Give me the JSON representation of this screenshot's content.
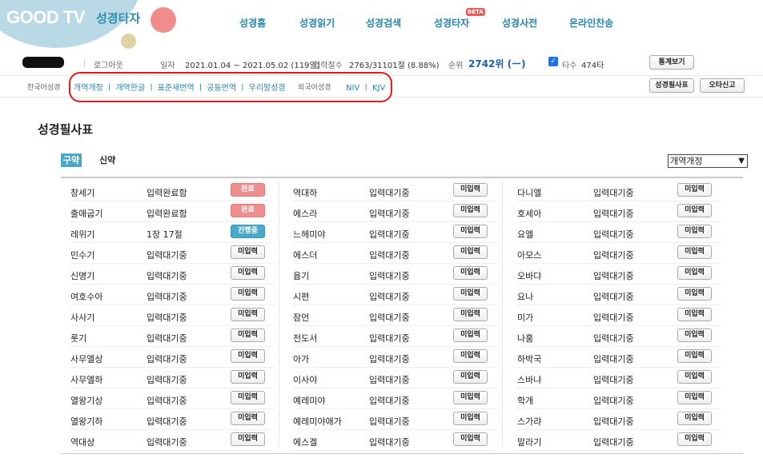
{
  "brand": {
    "logo": "GOOD TV",
    "subtitle": "성경타자"
  },
  "nav": {
    "items": [
      "성경홈",
      "성경읽기",
      "성경검색",
      "성경타자",
      "성경사전",
      "온라인찬송"
    ],
    "beta": "BETA"
  },
  "info": {
    "logout": "로그아웃",
    "period_label": "일자",
    "period_value": "2021.01.04 ~ 2021.05.02 (119일)",
    "verses_label": "입력절수",
    "verses_value": "2763/31101절 (8.88%)",
    "rank_label": "순위",
    "rank_value": "2742위 (ー)",
    "typing_label": "타수",
    "typing_value": "474타",
    "stats_button": "통계보기"
  },
  "subbar": {
    "korean_label": "한국어성경",
    "korean_versions": "개역개정 ㅣ 개역한글 ㅣ 표준새번역 ㅣ 공동번역 ㅣ 우리말성경",
    "foreign_label": "외국어성경",
    "foreign_versions": "NIV ㅣ KJV",
    "copy_button": "성경필사표",
    "typo_button": "오타신고"
  },
  "page": {
    "title": "성경필사표",
    "tab_old": "구약",
    "tab_new": "신약",
    "version_select": "개역개정"
  },
  "colors": {
    "accent": "#2586ad",
    "done": "#ee8f8f",
    "progress": "#4aa8c9",
    "highlight": "#e01b1b"
  },
  "columns": [
    [
      {
        "book": "창세기",
        "status": "입력완료함",
        "button": "완료",
        "state": "done"
      },
      {
        "book": "출애굽기",
        "status": "입력완료함",
        "button": "완료",
        "state": "done"
      },
      {
        "book": "레위기",
        "status": "1장 17절",
        "button": "진행중",
        "state": "prog"
      },
      {
        "book": "민수기",
        "status": "입력대기중",
        "button": "미입력",
        "state": "none"
      },
      {
        "book": "신명기",
        "status": "입력대기중",
        "button": "미입력",
        "state": "none"
      },
      {
        "book": "여호수아",
        "status": "입력대기중",
        "button": "미입력",
        "state": "none"
      },
      {
        "book": "사사기",
        "status": "입력대기중",
        "button": "미입력",
        "state": "none"
      },
      {
        "book": "룻기",
        "status": "입력대기중",
        "button": "미입력",
        "state": "none"
      },
      {
        "book": "사무엘상",
        "status": "입력대기중",
        "button": "미입력",
        "state": "none"
      },
      {
        "book": "사무엘하",
        "status": "입력대기중",
        "button": "미입력",
        "state": "none"
      },
      {
        "book": "열왕기상",
        "status": "입력대기중",
        "button": "미입력",
        "state": "none"
      },
      {
        "book": "열왕기하",
        "status": "입력대기중",
        "button": "미입력",
        "state": "none"
      },
      {
        "book": "역대상",
        "status": "입력대기중",
        "button": "미입력",
        "state": "none"
      }
    ],
    [
      {
        "book": "역대하",
        "status": "입력대기중",
        "button": "미입력",
        "state": "none"
      },
      {
        "book": "에스라",
        "status": "입력대기중",
        "button": "미입력",
        "state": "none"
      },
      {
        "book": "느헤미야",
        "status": "입력대기중",
        "button": "미입력",
        "state": "none"
      },
      {
        "book": "에스더",
        "status": "입력대기중",
        "button": "미입력",
        "state": "none"
      },
      {
        "book": "욥기",
        "status": "입력대기중",
        "button": "미입력",
        "state": "none"
      },
      {
        "book": "시편",
        "status": "입력대기중",
        "button": "미입력",
        "state": "none"
      },
      {
        "book": "잠언",
        "status": "입력대기중",
        "button": "미입력",
        "state": "none"
      },
      {
        "book": "전도서",
        "status": "입력대기중",
        "button": "미입력",
        "state": "none"
      },
      {
        "book": "아가",
        "status": "입력대기중",
        "button": "미입력",
        "state": "none"
      },
      {
        "book": "이사야",
        "status": "입력대기중",
        "button": "미입력",
        "state": "none"
      },
      {
        "book": "예레미야",
        "status": "입력대기중",
        "button": "미입력",
        "state": "none"
      },
      {
        "book": "예레미야애가",
        "status": "입력대기중",
        "button": "미입력",
        "state": "none"
      },
      {
        "book": "에스겔",
        "status": "입력대기중",
        "button": "미입력",
        "state": "none"
      }
    ],
    [
      {
        "book": "다니엘",
        "status": "입력대기중",
        "button": "미입력",
        "state": "none"
      },
      {
        "book": "호세아",
        "status": "입력대기중",
        "button": "미입력",
        "state": "none"
      },
      {
        "book": "요엘",
        "status": "입력대기중",
        "button": "미입력",
        "state": "none"
      },
      {
        "book": "아모스",
        "status": "입력대기중",
        "button": "미입력",
        "state": "none"
      },
      {
        "book": "오바댜",
        "status": "입력대기중",
        "button": "미입력",
        "state": "none"
      },
      {
        "book": "요나",
        "status": "입력대기중",
        "button": "미입력",
        "state": "none"
      },
      {
        "book": "미가",
        "status": "입력대기중",
        "button": "미입력",
        "state": "none"
      },
      {
        "book": "나훔",
        "status": "입력대기중",
        "button": "미입력",
        "state": "none"
      },
      {
        "book": "하박국",
        "status": "입력대기중",
        "button": "미입력",
        "state": "none"
      },
      {
        "book": "스바냐",
        "status": "입력대기중",
        "button": "미입력",
        "state": "none"
      },
      {
        "book": "학개",
        "status": "입력대기중",
        "button": "미입력",
        "state": "none"
      },
      {
        "book": "스가랴",
        "status": "입력대기중",
        "button": "미입력",
        "state": "none"
      },
      {
        "book": "말라기",
        "status": "입력대기중",
        "button": "미입력",
        "state": "none"
      }
    ]
  ]
}
